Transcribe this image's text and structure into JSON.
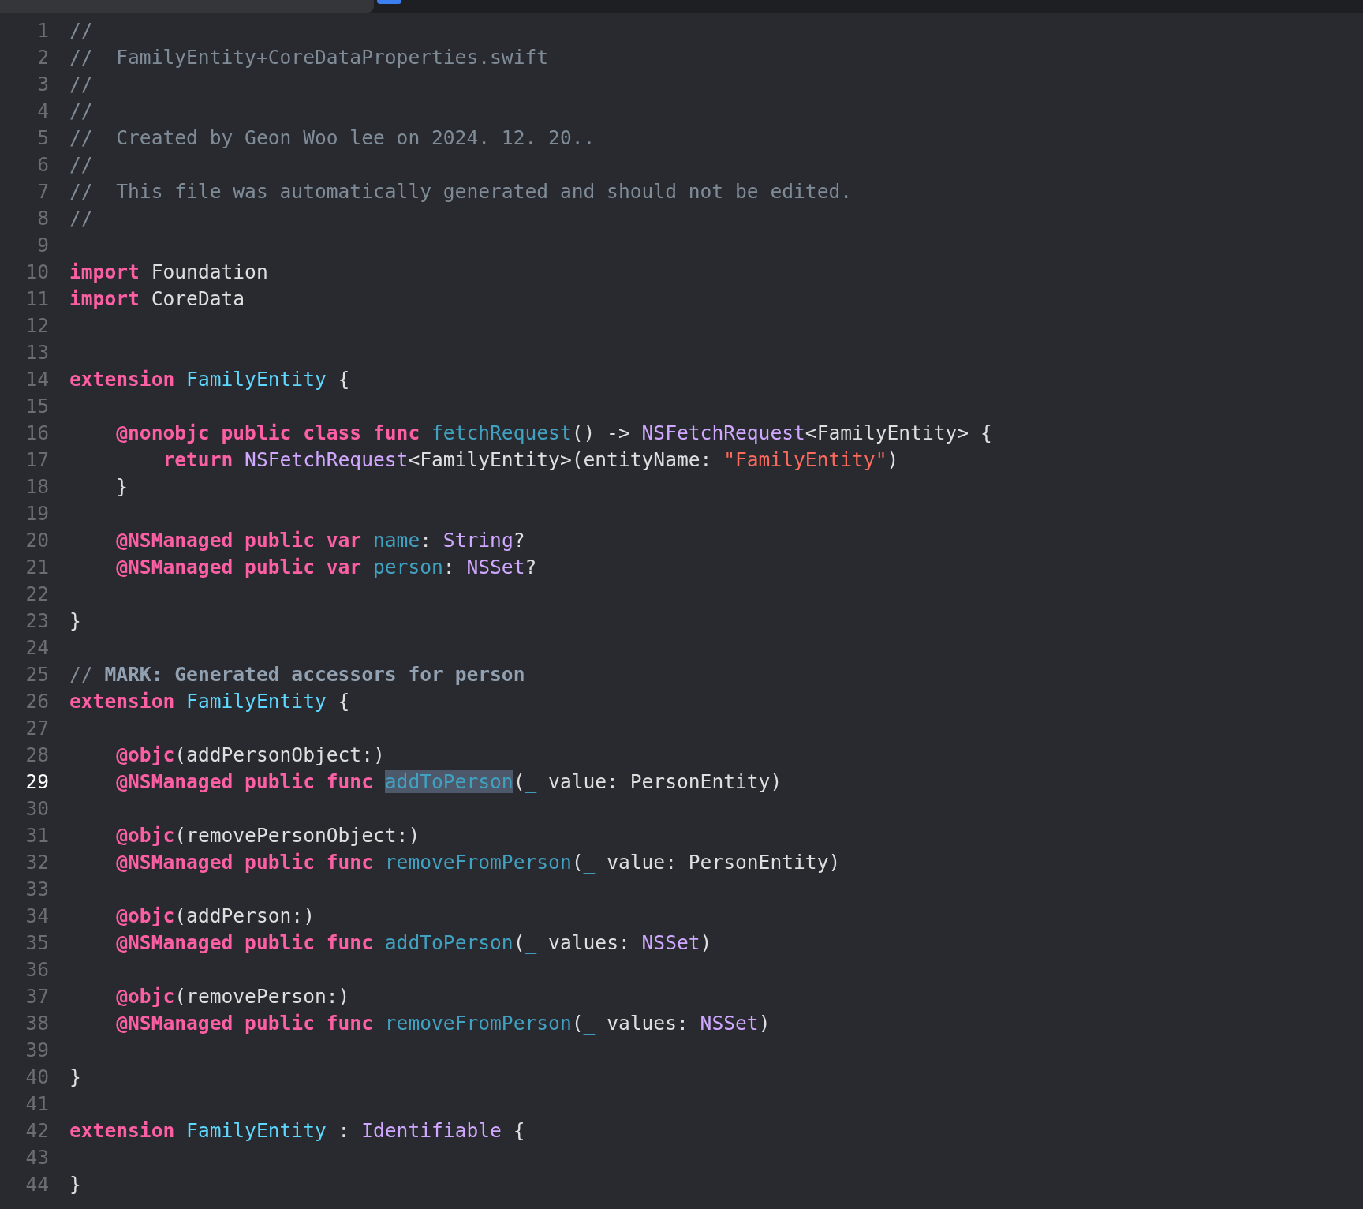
{
  "editor": {
    "lines": [
      {
        "number": "1",
        "current": false,
        "tokens": [
          {
            "kind": "comment",
            "text": "//"
          }
        ]
      },
      {
        "number": "2",
        "current": false,
        "tokens": [
          {
            "kind": "comment",
            "text": "//  FamilyEntity+CoreDataProperties.swift"
          }
        ]
      },
      {
        "number": "3",
        "current": false,
        "tokens": [
          {
            "kind": "comment",
            "text": "//"
          }
        ]
      },
      {
        "number": "4",
        "current": false,
        "tokens": [
          {
            "kind": "comment",
            "text": "//"
          }
        ]
      },
      {
        "number": "5",
        "current": false,
        "tokens": [
          {
            "kind": "comment",
            "text": "//  Created by Geon Woo lee on 2024. 12. 20.."
          }
        ]
      },
      {
        "number": "6",
        "current": false,
        "tokens": [
          {
            "kind": "comment",
            "text": "//"
          }
        ]
      },
      {
        "number": "7",
        "current": false,
        "tokens": [
          {
            "kind": "comment",
            "text": "//  This file was automatically generated and should not be edited."
          }
        ]
      },
      {
        "number": "8",
        "current": false,
        "tokens": [
          {
            "kind": "comment",
            "text": "//"
          }
        ]
      },
      {
        "number": "9",
        "current": false
      },
      {
        "number": "10",
        "current": false,
        "tokens": [
          {
            "kind": "keyword",
            "text": "import"
          },
          {
            "kind": "plain",
            "text": " Foundation"
          }
        ]
      },
      {
        "number": "11",
        "current": false,
        "tokens": [
          {
            "kind": "keyword",
            "text": "import"
          },
          {
            "kind": "plain",
            "text": " CoreData"
          }
        ]
      },
      {
        "number": "12",
        "current": false
      },
      {
        "number": "13",
        "current": false
      },
      {
        "number": "14",
        "current": false,
        "tokens": [
          {
            "kind": "keyword",
            "text": "extension"
          },
          {
            "kind": "typedecl",
            "text": " FamilyEntity"
          },
          {
            "kind": "plain",
            "text": " {"
          }
        ]
      },
      {
        "number": "15",
        "current": false
      },
      {
        "number": "16",
        "current": false,
        "tokens": [
          {
            "kind": "keyword",
            "text": "    @nonobjc public class func"
          },
          {
            "kind": "decl",
            "text": " fetchRequest"
          },
          {
            "kind": "plain",
            "text": "() -> "
          },
          {
            "kind": "type",
            "text": "NSFetchRequest"
          },
          {
            "kind": "plain",
            "text": "<FamilyEntity> {"
          }
        ]
      },
      {
        "number": "17",
        "current": false,
        "tokens": [
          {
            "kind": "keyword",
            "text": "        return"
          },
          {
            "kind": "type",
            "text": " NSFetchRequest"
          },
          {
            "kind": "plain",
            "text": "<FamilyEntity>(entityName: "
          },
          {
            "kind": "string",
            "text": "\"FamilyEntity\""
          },
          {
            "kind": "plain",
            "text": ")"
          }
        ]
      },
      {
        "number": "18",
        "current": false,
        "tokens": [
          {
            "kind": "plain",
            "text": "    }"
          }
        ]
      },
      {
        "number": "19",
        "current": false
      },
      {
        "number": "20",
        "current": false,
        "tokens": [
          {
            "kind": "keyword",
            "text": "    @NSManaged public var"
          },
          {
            "kind": "decl",
            "text": " name"
          },
          {
            "kind": "plain",
            "text": ": "
          },
          {
            "kind": "type",
            "text": "String"
          },
          {
            "kind": "plain",
            "text": "?"
          }
        ]
      },
      {
        "number": "21",
        "current": false,
        "tokens": [
          {
            "kind": "keyword",
            "text": "    @NSManaged public var"
          },
          {
            "kind": "decl",
            "text": " person"
          },
          {
            "kind": "plain",
            "text": ": "
          },
          {
            "kind": "type",
            "text": "NSSet"
          },
          {
            "kind": "plain",
            "text": "?"
          }
        ]
      },
      {
        "number": "22",
        "current": false
      },
      {
        "number": "23",
        "current": false,
        "tokens": [
          {
            "kind": "plain",
            "text": "}"
          }
        ]
      },
      {
        "number": "24",
        "current": false
      },
      {
        "number": "25",
        "current": false,
        "tokens": [
          {
            "kind": "comment",
            "text": "//"
          },
          {
            "kind": "mark",
            "text": " MARK: Generated accessors for person"
          }
        ]
      },
      {
        "number": "26",
        "current": false,
        "tokens": [
          {
            "kind": "keyword",
            "text": "extension"
          },
          {
            "kind": "typedecl",
            "text": " FamilyEntity"
          },
          {
            "kind": "plain",
            "text": " {"
          }
        ]
      },
      {
        "number": "27",
        "current": false
      },
      {
        "number": "28",
        "current": false,
        "tokens": [
          {
            "kind": "keyword",
            "text": "    @objc"
          },
          {
            "kind": "plain",
            "text": "(addPersonObject:)"
          }
        ]
      },
      {
        "number": "29",
        "current": true,
        "tokens": [
          {
            "kind": "keyword",
            "text": "    @NSManaged public func "
          },
          {
            "kind": "match",
            "text": "addToPerson"
          },
          {
            "kind": "plain",
            "text": "("
          },
          {
            "kind": "decl",
            "text": "_"
          },
          {
            "kind": "plain",
            "text": " value: PersonEntity)"
          }
        ]
      },
      {
        "number": "30",
        "current": false
      },
      {
        "number": "31",
        "current": false,
        "tokens": [
          {
            "kind": "keyword",
            "text": "    @objc"
          },
          {
            "kind": "plain",
            "text": "(removePersonObject:)"
          }
        ]
      },
      {
        "number": "32",
        "current": false,
        "tokens": [
          {
            "kind": "keyword",
            "text": "    @NSManaged public func"
          },
          {
            "kind": "decl",
            "text": " removeFromPerson"
          },
          {
            "kind": "plain",
            "text": "("
          },
          {
            "kind": "decl",
            "text": "_"
          },
          {
            "kind": "plain",
            "text": " value: PersonEntity)"
          }
        ]
      },
      {
        "number": "33",
        "current": false
      },
      {
        "number": "34",
        "current": false,
        "tokens": [
          {
            "kind": "keyword",
            "text": "    @objc"
          },
          {
            "kind": "plain",
            "text": "(addPerson:)"
          }
        ]
      },
      {
        "number": "35",
        "current": false,
        "tokens": [
          {
            "kind": "keyword",
            "text": "    @NSManaged public func"
          },
          {
            "kind": "decl",
            "text": " addToPerson"
          },
          {
            "kind": "plain",
            "text": "("
          },
          {
            "kind": "decl",
            "text": "_"
          },
          {
            "kind": "plain",
            "text": " values: "
          },
          {
            "kind": "type",
            "text": "NSSet"
          },
          {
            "kind": "plain",
            "text": ")"
          }
        ]
      },
      {
        "number": "36",
        "current": false
      },
      {
        "number": "37",
        "current": false,
        "tokens": [
          {
            "kind": "keyword",
            "text": "    @objc"
          },
          {
            "kind": "plain",
            "text": "(removePerson:)"
          }
        ]
      },
      {
        "number": "38",
        "current": false,
        "tokens": [
          {
            "kind": "keyword",
            "text": "    @NSManaged public func"
          },
          {
            "kind": "decl",
            "text": " removeFromPerson"
          },
          {
            "kind": "plain",
            "text": "("
          },
          {
            "kind": "decl",
            "text": "_"
          },
          {
            "kind": "plain",
            "text": " values: "
          },
          {
            "kind": "type",
            "text": "NSSet"
          },
          {
            "kind": "plain",
            "text": ")"
          }
        ]
      },
      {
        "number": "39",
        "current": false
      },
      {
        "number": "40",
        "current": false,
        "tokens": [
          {
            "kind": "plain",
            "text": "}"
          }
        ]
      },
      {
        "number": "41",
        "current": false
      },
      {
        "number": "42",
        "current": false,
        "tokens": [
          {
            "kind": "keyword",
            "text": "extension"
          },
          {
            "kind": "typedecl",
            "text": " FamilyEntity"
          },
          {
            "kind": "plain",
            "text": " : "
          },
          {
            "kind": "type",
            "text": "Identifiable"
          },
          {
            "kind": "plain",
            "text": " {"
          }
        ]
      },
      {
        "number": "43",
        "current": false
      },
      {
        "number": "44",
        "current": false,
        "tokens": [
          {
            "kind": "plain",
            "text": "}"
          }
        ]
      }
    ]
  }
}
